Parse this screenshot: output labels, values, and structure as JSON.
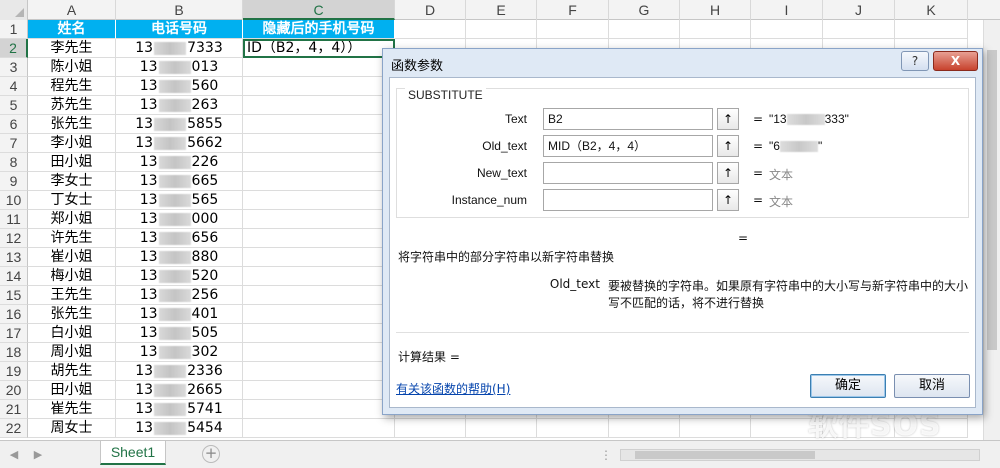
{
  "columns": [
    "A",
    "B",
    "C",
    "D",
    "E",
    "F",
    "G",
    "H",
    "I",
    "J",
    "K"
  ],
  "rows": [
    1,
    2,
    3,
    4,
    5,
    6,
    7,
    8,
    9,
    10,
    11,
    12,
    13,
    14,
    15,
    16,
    17,
    18,
    19,
    20,
    21,
    22
  ],
  "headers": {
    "name": "姓名",
    "phone": "电话号码",
    "hidden": "隐藏后的手机号码"
  },
  "active_cell_text": "ID（B2，4，4））",
  "records": [
    {
      "name": "李先生",
      "pre": "13",
      "post": "7333"
    },
    {
      "name": "陈小姐",
      "pre": "13",
      "post": "013"
    },
    {
      "name": "程先生",
      "pre": "13",
      "post": "560"
    },
    {
      "name": "苏先生",
      "pre": "13",
      "post": "263"
    },
    {
      "name": "张先生",
      "pre": "13",
      "post": "5855"
    },
    {
      "name": "李小姐",
      "pre": "13",
      "post": "5662"
    },
    {
      "name": "田小姐",
      "pre": "13",
      "post": "226"
    },
    {
      "name": "李女士",
      "pre": "13",
      "post": "665"
    },
    {
      "name": "丁女士",
      "pre": "13",
      "post": "565"
    },
    {
      "name": "郑小姐",
      "pre": "13",
      "post": "000"
    },
    {
      "name": "许先生",
      "pre": "13",
      "post": "656"
    },
    {
      "name": "崔小姐",
      "pre": "13",
      "post": "880"
    },
    {
      "name": "梅小姐",
      "pre": "13",
      "post": "520"
    },
    {
      "name": "王先生",
      "pre": "13",
      "post": "256"
    },
    {
      "name": "张先生",
      "pre": "13",
      "post": "401"
    },
    {
      "name": "白小姐",
      "pre": "13",
      "post": "505"
    },
    {
      "name": "周小姐",
      "pre": "13",
      "post": "302"
    },
    {
      "name": "胡先生",
      "pre": "13",
      "post": "2336"
    },
    {
      "name": "田小姐",
      "pre": "13",
      "post": "2665"
    },
    {
      "name": "崔先生",
      "pre": "13",
      "post": "5741"
    },
    {
      "name": "周女士",
      "pre": "13",
      "post": "5454"
    }
  ],
  "sheet_tab": "Sheet1",
  "add_sheet": "+",
  "watermark": "软件SOS",
  "dialog": {
    "title": "函数参数",
    "help_btn": "?",
    "close_btn": "X",
    "function_name": "SUBSTITUTE",
    "args": [
      {
        "label": "Text",
        "value": "B2",
        "result_pre": "\"13",
        "result_post": "333\"",
        "blurred": true
      },
      {
        "label": "Old_text",
        "value": "MID（B2，4，4）",
        "result_pre": "\"6",
        "result_post": "\"",
        "blurred": true
      },
      {
        "label": "New_text",
        "value": "",
        "result": "文本",
        "blurred": false
      },
      {
        "label": "Instance_num",
        "value": "",
        "result": "文本",
        "blurred": false
      }
    ],
    "equals": "=",
    "arrow": "↑",
    "formula_result_eq": "=",
    "description": "将字符串中的部分字符串以新字符串替换",
    "param_name": "Old_text",
    "param_desc_line1": "要被替换的字符串。如果原有字符串中的大小写与新字符串中的大小",
    "param_desc_line2": "写不匹配的话，将不进行替换",
    "calc_result": "计算结果 =",
    "help_link": "有关该函数的帮助(H)",
    "ok": "确定",
    "cancel": "取消"
  }
}
